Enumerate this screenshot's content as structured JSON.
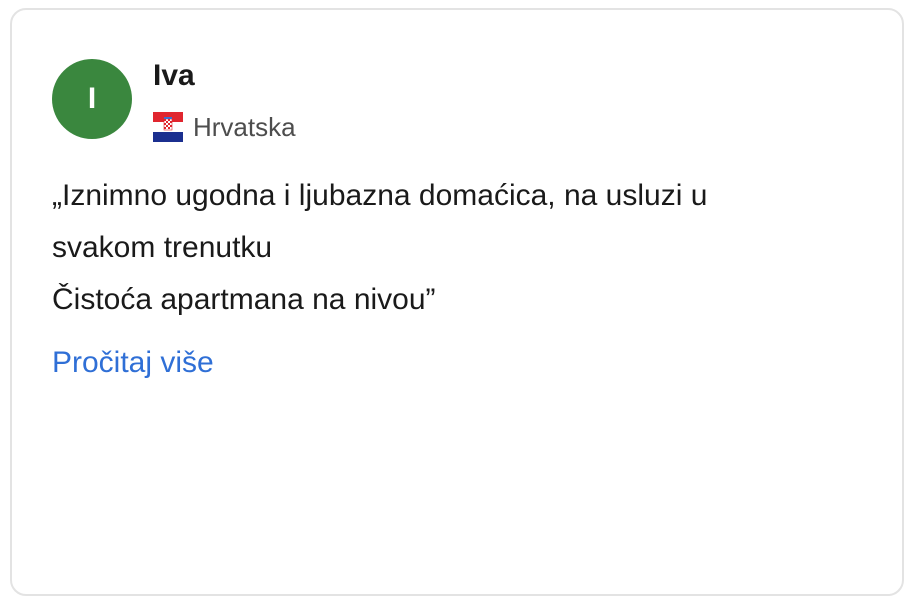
{
  "review": {
    "avatar_initial": "I",
    "avatar_color": "#3a873e",
    "reviewer_name": "Iva",
    "country_flag_icon": "croatia-flag-icon",
    "country": "Hrvatska",
    "text_lines": [
      "„Iznimno ugodna i ljubazna domaćica, na usluzi u",
      "svakom trenutku",
      "Čistoća apartmana na nivou”"
    ],
    "read_more_label": "Pročitaj više",
    "link_color": "#2f6fd6"
  }
}
